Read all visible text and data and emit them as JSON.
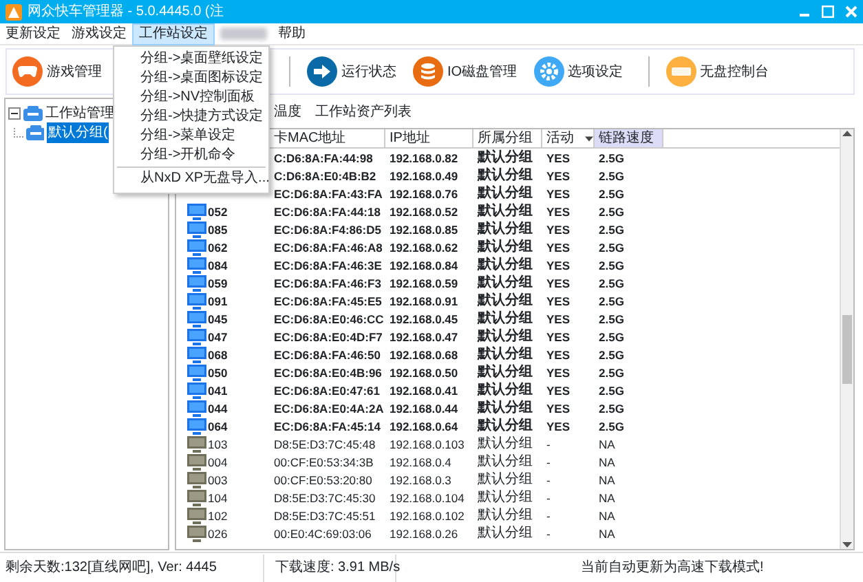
{
  "window": {
    "title": "网众快车管理器 - 5.0.4445.0 (注"
  },
  "menu": [
    {
      "label": "更新设定",
      "open": false
    },
    {
      "label": "游戏设定",
      "open": false
    },
    {
      "label": "工作站设定",
      "open": true
    },
    {
      "kind": "blurred"
    },
    {
      "label": "帮助",
      "open": false
    }
  ],
  "dropdown": [
    {
      "label": "分组->桌面壁纸设定",
      "divider_before": false
    },
    {
      "label": "分组->桌面图标设定",
      "divider_before": false
    },
    {
      "label": "分组->NV控制面板",
      "divider_before": false
    },
    {
      "label": "分组->快捷方式设定",
      "divider_before": false
    },
    {
      "label": "分组->菜单设定",
      "divider_before": false
    },
    {
      "label": "分组->开机命令",
      "divider_before": false
    },
    {
      "label": "从NxD XP无盘导入...",
      "divider_before": true
    }
  ],
  "toolbar": [
    {
      "kind": "gamepad",
      "label": "游戏管理"
    },
    {
      "kind": "covered"
    },
    {
      "kind": "arrow",
      "label": "运行状态"
    },
    {
      "kind": "disk",
      "label": "IO磁盘管理"
    },
    {
      "kind": "gear",
      "label": "选项设定"
    },
    {
      "kind": "nxd",
      "label": "无盘控制台"
    }
  ],
  "tree": [
    {
      "label": "工作站管理",
      "expanded": true,
      "children": [
        {
          "label": "默认分组(",
          "selected": true
        }
      ]
    }
  ],
  "tabs": [
    {
      "label": "温度"
    },
    {
      "label": "工作站资产列表"
    }
  ],
  "table": {
    "columns": [
      "卡MAC地址",
      "IP地址",
      "所属分组",
      "活动",
      "链路速度"
    ],
    "rows": [
      {
        "online": true,
        "mac": "C:D6:8A:FA:44:98",
        "ip": "192.168.0.82",
        "group": "默认分组",
        "active": "YES",
        "speed": "2.5G"
      },
      {
        "online": true,
        "mac": "C:D6:8A:E0:4B:B2",
        "ip": "192.168.0.49",
        "group": "默认分组",
        "active": "YES",
        "speed": "2.5G"
      },
      {
        "online": true,
        "mac": "EC:D6:8A:FA:43:FA",
        "ip": "192.168.0.76",
        "group": "默认分组",
        "active": "YES",
        "speed": "2.5G"
      },
      {
        "online": true,
        "name": "052",
        "mac": "EC:D6:8A:FA:44:18",
        "ip": "192.168.0.52",
        "group": "默认分组",
        "active": "YES",
        "speed": "2.5G"
      },
      {
        "online": true,
        "name": "085",
        "mac": "EC:D6:8A:F4:86:D5",
        "ip": "192.168.0.85",
        "group": "默认分组",
        "active": "YES",
        "speed": "2.5G"
      },
      {
        "online": true,
        "name": "062",
        "mac": "EC:D6:8A:FA:46:A8",
        "ip": "192.168.0.62",
        "group": "默认分组",
        "active": "YES",
        "speed": "2.5G"
      },
      {
        "online": true,
        "name": "084",
        "mac": "EC:D6:8A:FA:46:3E",
        "ip": "192.168.0.84",
        "group": "默认分组",
        "active": "YES",
        "speed": "2.5G"
      },
      {
        "online": true,
        "name": "059",
        "mac": "EC:D6:8A:FA:46:F3",
        "ip": "192.168.0.59",
        "group": "默认分组",
        "active": "YES",
        "speed": "2.5G"
      },
      {
        "online": true,
        "name": "091",
        "mac": "EC:D6:8A:FA:45:E5",
        "ip": "192.168.0.91",
        "group": "默认分组",
        "active": "YES",
        "speed": "2.5G"
      },
      {
        "online": true,
        "name": "045",
        "mac": "EC:D6:8A:E0:46:CC",
        "ip": "192.168.0.45",
        "group": "默认分组",
        "active": "YES",
        "speed": "2.5G"
      },
      {
        "online": true,
        "name": "047",
        "mac": "EC:D6:8A:E0:4D:F7",
        "ip": "192.168.0.47",
        "group": "默认分组",
        "active": "YES",
        "speed": "2.5G"
      },
      {
        "online": true,
        "name": "068",
        "mac": "EC:D6:8A:FA:46:50",
        "ip": "192.168.0.68",
        "group": "默认分组",
        "active": "YES",
        "speed": "2.5G"
      },
      {
        "online": true,
        "name": "050",
        "mac": "EC:D6:8A:E0:4B:96",
        "ip": "192.168.0.50",
        "group": "默认分组",
        "active": "YES",
        "speed": "2.5G"
      },
      {
        "online": true,
        "name": "041",
        "mac": "EC:D6:8A:E0:47:61",
        "ip": "192.168.0.41",
        "group": "默认分组",
        "active": "YES",
        "speed": "2.5G"
      },
      {
        "online": true,
        "name": "044",
        "mac": "EC:D6:8A:E0:4A:2A",
        "ip": "192.168.0.44",
        "group": "默认分组",
        "active": "YES",
        "speed": "2.5G"
      },
      {
        "online": true,
        "name": "064",
        "mac": "EC:D6:8A:FA:45:14",
        "ip": "192.168.0.64",
        "group": "默认分组",
        "active": "YES",
        "speed": "2.5G"
      },
      {
        "online": false,
        "name": "103",
        "mac": "D8:5E:D3:7C:45:48",
        "ip": "192.168.0.103",
        "group": "默认分组",
        "active": "-",
        "speed": "NA"
      },
      {
        "online": false,
        "name": "004",
        "mac": "00:CF:E0:53:34:3B",
        "ip": "192.168.0.4",
        "group": "默认分组",
        "active": "-",
        "speed": "NA"
      },
      {
        "online": false,
        "name": "003",
        "mac": "00:CF:E0:53:20:80",
        "ip": "192.168.0.3",
        "group": "默认分组",
        "active": "-",
        "speed": "NA"
      },
      {
        "online": false,
        "name": "104",
        "mac": "D8:5E:D3:7C:45:30",
        "ip": "192.168.0.104",
        "group": "默认分组",
        "active": "-",
        "speed": "NA"
      },
      {
        "online": false,
        "name": "102",
        "mac": "D8:5E:D3:7C:45:51",
        "ip": "192.168.0.102",
        "group": "默认分组",
        "active": "-",
        "speed": "NA"
      },
      {
        "online": false,
        "name": "026",
        "mac": "00:E0:4C:69:03:06",
        "ip": "192.168.0.26",
        "group": "默认分组",
        "active": "-",
        "speed": "NA"
      }
    ]
  },
  "status_bar": [
    "剩余天数:132[直线网吧], Ver: 4445",
    "下载速度: 3.91 MB/s",
    "当前自动更新为高速下载模式!"
  ]
}
